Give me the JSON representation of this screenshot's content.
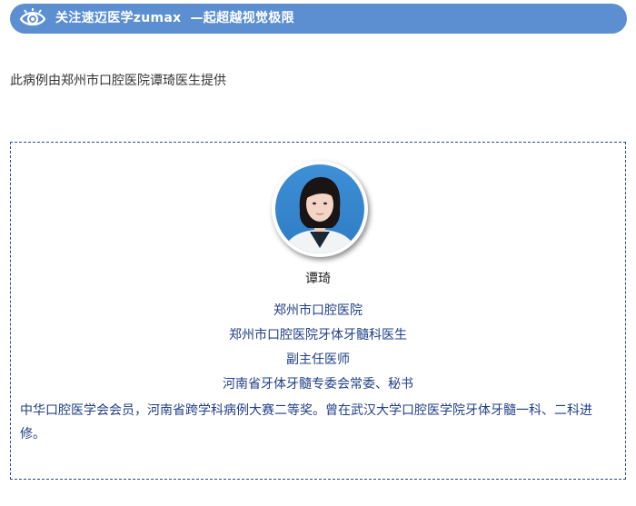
{
  "banner": {
    "eye_icon": "eye-icon",
    "title": "关注速迈医学zumax",
    "slogan": "—起超越视觉极限",
    "background": "#5b8fd1"
  },
  "credit": "此病例由郑州市口腔医院谭琦医生提供",
  "profile": {
    "name": "谭琦",
    "hospital": "郑州市口腔医院",
    "department": "郑州市口腔医院牙体牙髓科医生",
    "title": "副主任医师",
    "committee": "河南省牙体牙髓专委会常委、秘书",
    "bio": "中华口腔医学会会员，河南省跨学科病例大赛二等奖。曾在武汉大学口腔医学院牙体牙髓一科、二科进修。",
    "text_color": "#1f3f86"
  }
}
